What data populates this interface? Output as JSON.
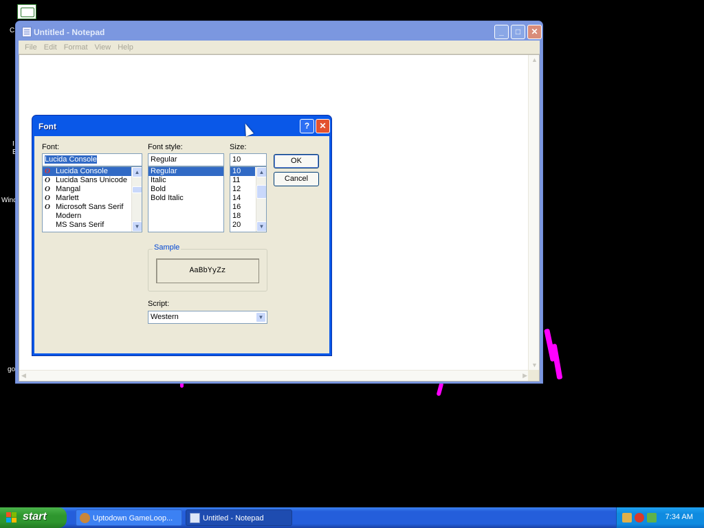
{
  "desktop": {
    "fragments": [
      "C",
      "I",
      "E",
      "Wind",
      "go"
    ]
  },
  "notepad": {
    "title": "Untitled - Notepad",
    "menu": [
      "File",
      "Edit",
      "Format",
      "View",
      "Help"
    ],
    "buttons": {
      "minimize": "_",
      "maximize": "□",
      "close": "✕"
    }
  },
  "font_dialog": {
    "title": "Font",
    "help_button": "?",
    "close_button": "✕",
    "font_label": "Font:",
    "font_value": "Lucida Console",
    "fonts": [
      "Lucida Console",
      "Lucida Sans Unicode",
      "Mangal",
      "Marlett",
      "Microsoft Sans Serif",
      "Modern",
      "MS Sans Serif"
    ],
    "font_type_glyph": "O",
    "style_label": "Font style:",
    "style_value": "Regular",
    "styles": [
      "Regular",
      "Italic",
      "Bold",
      "Bold Italic"
    ],
    "size_label": "Size:",
    "size_value": "10",
    "sizes": [
      "10",
      "11",
      "12",
      "14",
      "16",
      "18",
      "20"
    ],
    "ok_label": "OK",
    "cancel_label": "Cancel",
    "sample_label": "Sample",
    "sample_text": "AaBbYyZz",
    "script_label": "Script:",
    "script_value": "Western"
  },
  "taskbar": {
    "start_label": "start",
    "tasks": [
      "Uptodown GameLoop...",
      "Untitled - Notepad"
    ],
    "clock": "7:34 AM"
  },
  "colors": {
    "xp_blue": "#0a58e8",
    "selection": "#316ac5",
    "start_green": "#2e962e"
  }
}
